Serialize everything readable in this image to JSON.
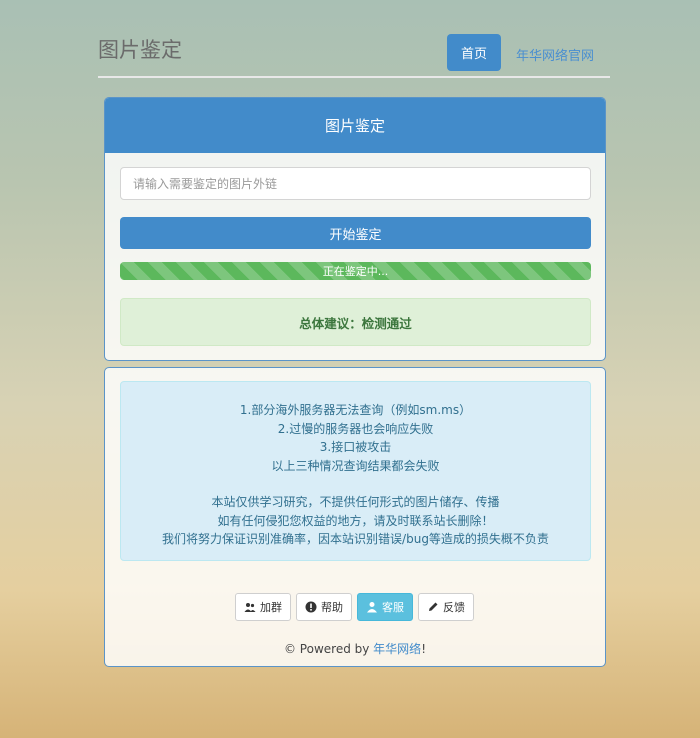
{
  "header": {
    "site_title": "图片鉴定",
    "nav": {
      "home_label": "首页",
      "official_label": "年华网络官网"
    }
  },
  "main_panel": {
    "title": "图片鉴定",
    "url_input": {
      "placeholder": "请输入需要鉴定的图片外链",
      "value": ""
    },
    "start_button_label": "开始鉴定",
    "progress": {
      "label": "正在鉴定中...",
      "percent": 100
    },
    "result_text": "总体建议：检测通过"
  },
  "info_panel": {
    "lines_a": [
      "1.部分海外服务器无法查询（例如sm.ms）",
      "2.过慢的服务器也会响应失败",
      "3.接口被攻击",
      "以上三种情况查询结果都会失败"
    ],
    "lines_b": [
      "本站仅供学习研究，不提供任何形式的图片储存、传播",
      "如有任何侵犯您权益的地方，请及时联系站长删除！",
      "我们将努力保证识别准确率，因本站识别错误/bug等造成的损失概不负责"
    ],
    "buttons": [
      {
        "label": "加群",
        "icon": "users-icon"
      },
      {
        "label": "帮助",
        "icon": "info-icon"
      },
      {
        "label": "客服",
        "icon": "user-icon"
      },
      {
        "label": "反馈",
        "icon": "pencil-icon"
      }
    ],
    "footer": {
      "prefix": "© Powered by ",
      "brand": "年华网络",
      "suffix": "!"
    }
  },
  "colors": {
    "primary": "#428bca",
    "success": "#5cb85c",
    "info_btn": "#5bc0de"
  }
}
